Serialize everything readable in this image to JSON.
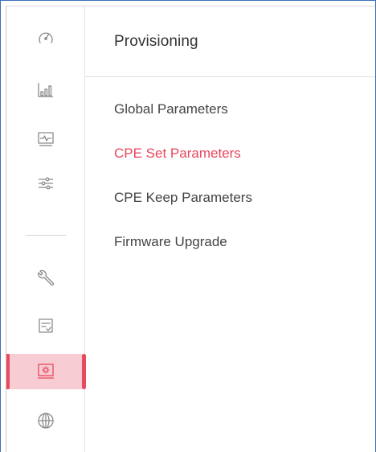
{
  "panel": {
    "title": "Provisioning"
  },
  "menu": {
    "items": [
      {
        "label": "Global Parameters",
        "active": false
      },
      {
        "label": "CPE Set Parameters",
        "active": true
      },
      {
        "label": "CPE Keep Parameters",
        "active": false
      },
      {
        "label": "Firmware Upgrade",
        "active": false
      }
    ]
  },
  "rail": {
    "items": [
      {
        "icon": "gauge-icon",
        "active": false
      },
      {
        "icon": "bar-chart-icon",
        "active": false
      },
      {
        "icon": "monitor-pulse-icon",
        "active": false
      },
      {
        "icon": "sliders-icon",
        "active": false
      },
      {
        "icon": "wrench-icon",
        "active": false
      },
      {
        "icon": "checklist-icon",
        "active": false
      },
      {
        "icon": "provisioning-gear-icon",
        "active": true
      },
      {
        "icon": "globe-icon",
        "active": false
      }
    ]
  },
  "colors": {
    "accent": "#e8475c",
    "active_bg": "#f7cdd3",
    "icon": "#8a8a8a",
    "text": "#444444",
    "frame": "#3b6fb6"
  }
}
